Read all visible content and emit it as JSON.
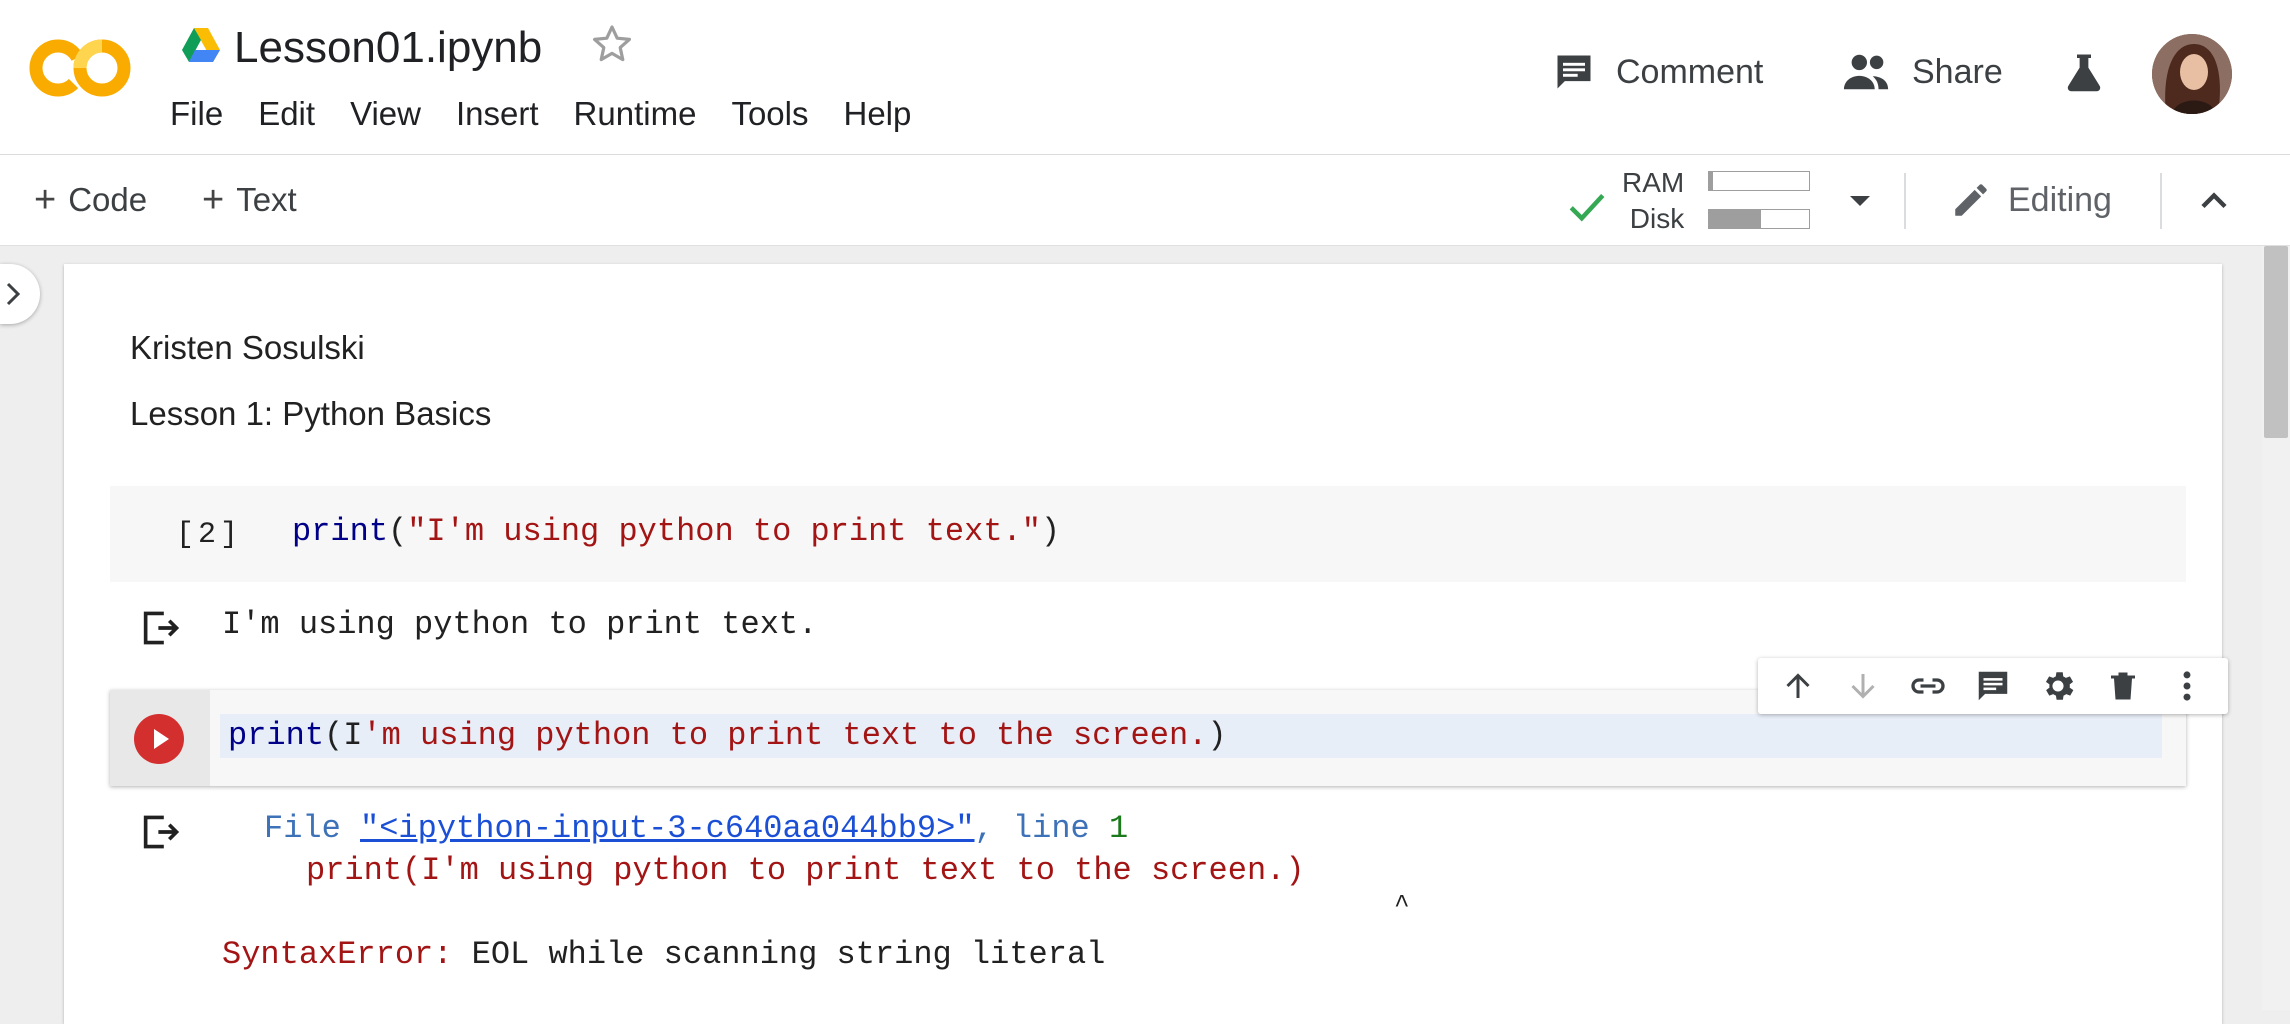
{
  "header": {
    "title": "Lesson01.ipynb",
    "menu": [
      "File",
      "Edit",
      "View",
      "Insert",
      "Runtime",
      "Tools",
      "Help"
    ],
    "comment_label": "Comment",
    "share_label": "Share",
    "logo_color": "#F9AB00"
  },
  "toolbar": {
    "add_code_label": "Code",
    "add_text_label": "Text",
    "ram_label": "RAM",
    "disk_label": "Disk",
    "ram_fraction": 0.04,
    "disk_fraction": 0.52,
    "editing_label": "Editing"
  },
  "notebook": {
    "text_cell": {
      "line1": "Kristen Sosulski",
      "line2": "Lesson 1: Python Basics"
    },
    "cell1": {
      "exec_count": "[2]",
      "code_func": "print",
      "code_open": "(",
      "code_string": "\"I'm using python to print text.\"",
      "code_close": ")",
      "output": "I'm using python to print text."
    },
    "cell2": {
      "code_func": "print",
      "code_open": "(I",
      "code_rest": "'m using python to print text to the screen.",
      "code_close": ")",
      "error": {
        "file_kw": "File",
        "file_link": "\"<ipython-input-3-c640aa044bb9>\"",
        "comma": ",",
        "line_kw": "line",
        "line_no": "1",
        "code_echo": "print(I'm using python to print text to the screen.)",
        "caret": "^",
        "error_type": "SyntaxError:",
        "error_msg": "EOL while scanning string literal"
      }
    }
  },
  "icons": [
    "colab-logo-icon",
    "drive-icon",
    "star-icon",
    "comment-icon",
    "people-icon",
    "flask-icon",
    "check-icon",
    "chevron-down-icon",
    "pencil-icon",
    "chevron-up-icon",
    "chevron-right-icon",
    "output-icon",
    "play-icon",
    "arrow-up-icon",
    "arrow-down-icon",
    "link-icon",
    "comment-icon",
    "gear-icon",
    "trash-icon",
    "more-vert-icon"
  ]
}
